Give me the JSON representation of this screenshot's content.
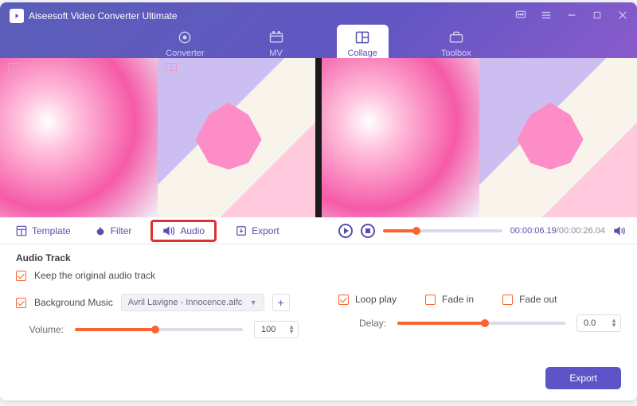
{
  "app": {
    "title": "Aiseesoft Video Converter Ultimate"
  },
  "nav": {
    "converter": "Converter",
    "mv": "MV",
    "collage": "Collage",
    "toolbox": "Toolbox"
  },
  "subtabs": {
    "template": "Template",
    "filter": "Filter",
    "audio": "Audio",
    "export": "Export"
  },
  "player": {
    "current": "00:00:06.19",
    "total": "00:00:26.04",
    "progress_pct": 28
  },
  "audio_panel": {
    "heading": "Audio Track",
    "keep_original_label": "Keep the original audio track",
    "bg_music_label": "Background Music",
    "bg_music_selected": "Avril Lavigne - Innocence.aifc",
    "volume_label": "Volume:",
    "volume_value": "100",
    "volume_pct": 48,
    "loop_label": "Loop play",
    "fadein_label": "Fade in",
    "fadeout_label": "Fade out",
    "delay_label": "Delay:",
    "delay_value": "0.0",
    "delay_pct": 52
  },
  "footer": {
    "export": "Export"
  },
  "colors": {
    "accent": "#fb6330",
    "brand": "#574fb0"
  }
}
